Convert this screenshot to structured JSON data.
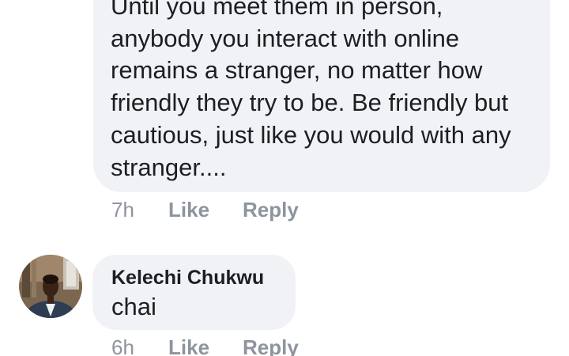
{
  "comments": [
    {
      "text_lines": [
        "Until you meet them in person,",
        "anybody you interact with online",
        "remains a stranger, no matter how",
        "friendly they try to be. Be friendly but",
        "cautious, just like you would with any",
        "stranger...."
      ],
      "time": "7h",
      "like_label": "Like",
      "reply_label": "Reply"
    },
    {
      "author": "Kelechi Chukwu",
      "avatar_icon": "profile-photo",
      "text": "chai",
      "time": "6h",
      "like_label": "Like",
      "reply_label": "Reply"
    }
  ],
  "colors": {
    "bubble_bg": "#f0f2f5",
    "text": "#1c1e21",
    "meta": "#8d949e"
  }
}
